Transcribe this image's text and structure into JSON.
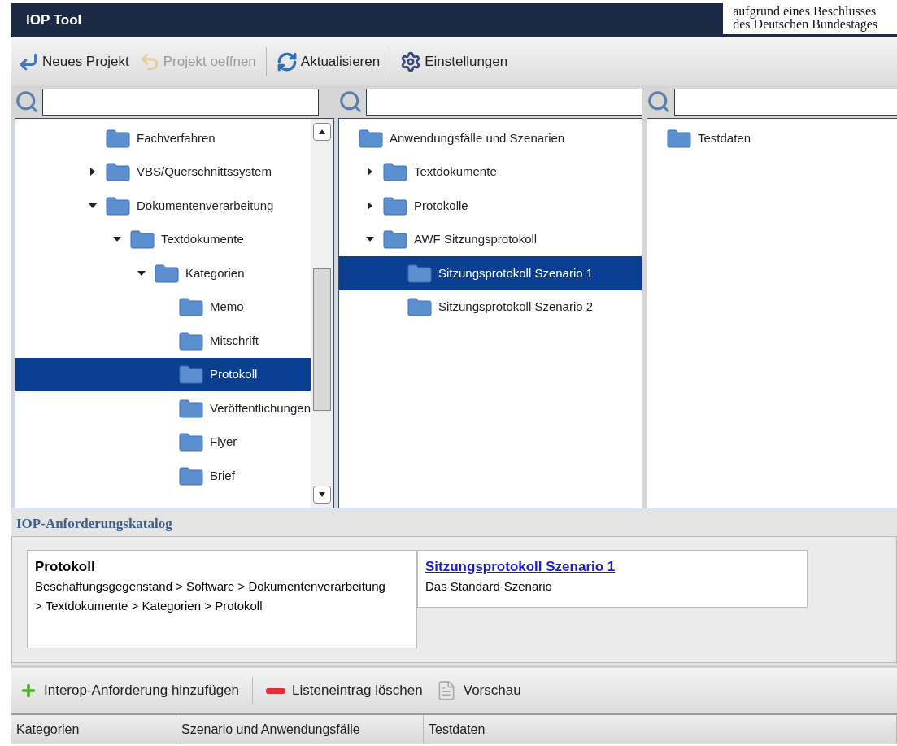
{
  "window": {
    "title": "IOP Tool"
  },
  "badge": {
    "lines": [
      "aufgrund eines Beschlusses",
      "des Deutschen Bundestages"
    ]
  },
  "toolbar": [
    {
      "label": "Neues Projekt",
      "kind": "new",
      "disabled": false
    },
    {
      "label": "Projekt oeffnen",
      "kind": "open",
      "disabled": true
    },
    {
      "label": "Aktualisieren",
      "kind": "refresh",
      "disabled": false
    },
    {
      "label": "Einstellungen",
      "kind": "settings",
      "disabled": false
    }
  ],
  "panels": [
    {
      "scrollbar": true,
      "items": [
        {
          "label": "Fachverfahren",
          "selected": false
        },
        {
          "label": "VBS/Querschnittssystem",
          "selected": false,
          "expanded": false
        },
        {
          "label": "Dokumentenverarbeitung",
          "selected": false,
          "expanded": true,
          "children": [
            {
              "label": "Textdokumente",
              "selected": false,
              "expanded": true,
              "children": [
                {
                  "label": "Kategorien",
                  "selected": false,
                  "expanded": true,
                  "children": [
                    {
                      "label": "Memo",
                      "selected": false
                    },
                    {
                      "label": "Mitschrift",
                      "selected": false
                    },
                    {
                      "label": "Protokoll",
                      "selected": true
                    },
                    {
                      "label": "Veröffentlichungen",
                      "selected": false
                    },
                    {
                      "label": "Flyer",
                      "selected": false
                    },
                    {
                      "label": "Brief",
                      "selected": false
                    }
                  ]
                }
              ]
            }
          ]
        }
      ]
    },
    {
      "scrollbar": false,
      "items": [
        {
          "label": "Anwendungsfälle und Szenarien",
          "selected": false,
          "children": [
            {
              "label": "Textdokumente",
              "selected": false,
              "expanded": false
            },
            {
              "label": "Protokolle",
              "selected": false,
              "expanded": false
            },
            {
              "label": "AWF Sitzungsprotokoll",
              "selected": false,
              "expanded": true,
              "children": [
                {
                  "label": "Sitzungsprotokoll Szenario 1",
                  "selected": true
                },
                {
                  "label": "Sitzungsprotokoll Szenario 2",
                  "selected": false
                }
              ]
            }
          ]
        }
      ]
    },
    {
      "scrollbar": false,
      "items": [
        {
          "label": "Testdaten",
          "selected": false
        }
      ]
    }
  ],
  "catalog": {
    "title": "IOP-Anforderungskatalog",
    "cards": [
      {
        "kind": "category",
        "title": "Protokoll",
        "text": "Beschaffungsgegenstand > Software > Dokumentenverarbeitung > Textdokumente > Kategorien > Protokoll"
      },
      {
        "kind": "scenario",
        "title": "Sitzungsprotokoll Szenario 1",
        "text": "Das Standard-Szenario"
      }
    ]
  },
  "actions": [
    {
      "label": "Interop-Anforderung hinzufügen",
      "kind": "add"
    },
    {
      "label": "Listeneintrag löschen",
      "kind": "delete"
    },
    {
      "label": "Vorschau",
      "kind": "preview"
    }
  ],
  "table": {
    "columns": [
      "Kategorien",
      "Szenario und Anwendungsfälle",
      "Testdaten"
    ]
  }
}
